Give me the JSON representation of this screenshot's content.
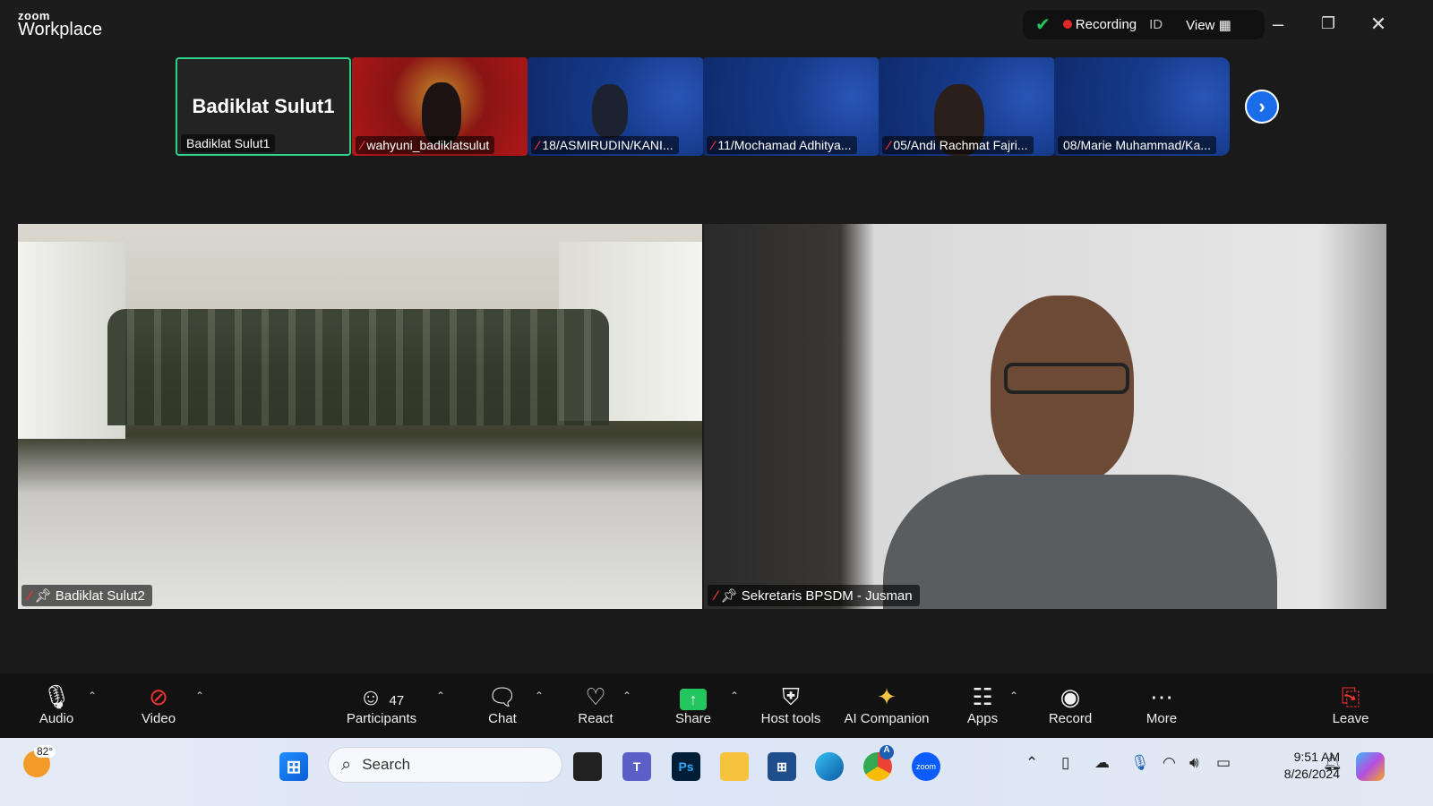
{
  "app": {
    "brand_small": "zoom",
    "brand_big": "Workplace"
  },
  "status": {
    "recording": "Recording",
    "id": "ID",
    "view": "View"
  },
  "thumbnails": [
    {
      "name": "Badiklat Sulut1",
      "display": "Badiklat Sulut1",
      "active": true
    },
    {
      "name": "wahyuni_badiklatsulut",
      "muted": true
    },
    {
      "name": "18/ASMIRUDIN/KANI...",
      "muted": true
    },
    {
      "name": "11/Mochamad Adhitya...",
      "muted": true
    },
    {
      "name": "05/Andi Rachmat Fajri...",
      "muted": true
    },
    {
      "name": "08/Marie Muhammad/Ka...",
      "muted": false
    }
  ],
  "main_videos": [
    {
      "name": "Badiklat Sulut2",
      "muted": true,
      "pinned": true
    },
    {
      "name": "Sekretaris BPSDM - Jusman",
      "muted": true,
      "pinned": true
    }
  ],
  "toolbar": {
    "audio": "Audio",
    "video": "Video",
    "participants": "Participants",
    "participants_count": "47",
    "chat": "Chat",
    "react": "React",
    "share": "Share",
    "host_tools": "Host tools",
    "ai": "AI Companion",
    "apps": "Apps",
    "record": "Record",
    "more": "More",
    "leave": "Leave"
  },
  "taskbar": {
    "weather": "82°",
    "search_placeholder": "Search",
    "time": "9:51 AM",
    "date": "8/26/2024",
    "chrome_badge": "A",
    "zoom_label": "zoom",
    "ps": "Ps"
  },
  "colors": {
    "accent_active": "#2ed18a",
    "share_green": "#22c55e",
    "rec_red": "#e02828",
    "next_blue": "#1a6dea"
  }
}
